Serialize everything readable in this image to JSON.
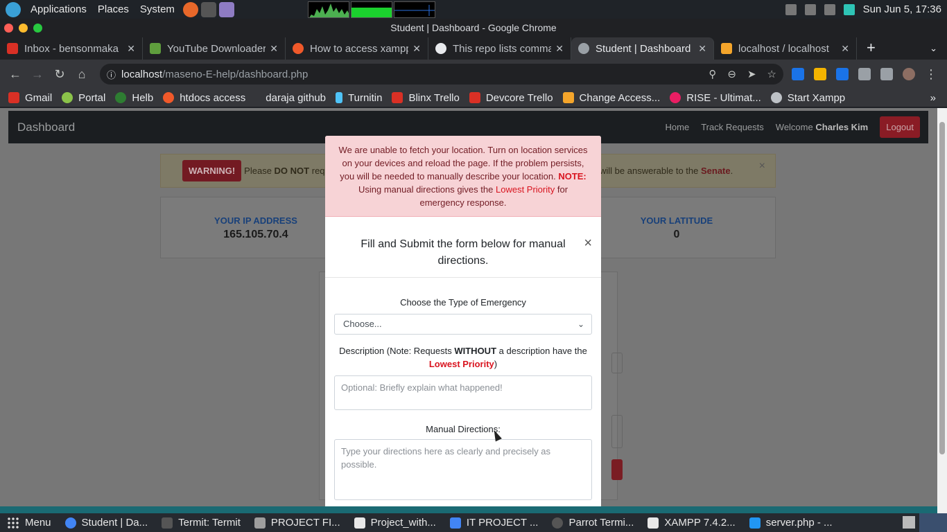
{
  "system_bar": {
    "menus": [
      "Applications",
      "Places",
      "System"
    ],
    "clock": "Sun Jun  5, 17:36"
  },
  "window": {
    "title": "Student | Dashboard - Google Chrome"
  },
  "tabs": [
    {
      "label": "Inbox - bensonmaka",
      "color": "#d93025"
    },
    {
      "label": "YouTube Downloader",
      "color": "#5f9e3d"
    },
    {
      "label": "How to access xampp",
      "color": "#f0592a"
    },
    {
      "label": "This repo lists comma",
      "color": "#e8eaed"
    },
    {
      "label": "Student | Dashboard",
      "color": "#9aa0a6"
    },
    {
      "label": "localhost / localhost",
      "color": "#f4a52b"
    }
  ],
  "address": {
    "host": "localhost",
    "path": "/maseno-E-help/dashboard.php"
  },
  "bookmarks": [
    {
      "label": "Gmail",
      "color": "#d93025"
    },
    {
      "label": "Portal",
      "color": "#8bc34a"
    },
    {
      "label": "Helb",
      "color": "#2e7d32"
    },
    {
      "label": "htdocs access",
      "color": "#f0592a"
    },
    {
      "label": "daraja github",
      "color": "#35363a"
    },
    {
      "label": "Turnitin",
      "color": "#4fc3f7"
    },
    {
      "label": "Blinx Trello",
      "color": "#d93025"
    },
    {
      "label": "Devcore Trello",
      "color": "#d93025"
    },
    {
      "label": "Change Access...",
      "color": "#f4a52b"
    },
    {
      "label": "RISE - Ultimat...",
      "color": "#e91e63"
    },
    {
      "label": "Start Xampp",
      "color": "#bdc1c6"
    }
  ],
  "page": {
    "brand": "Dashboard",
    "nav": {
      "home": "Home",
      "track": "Track Requests",
      "welcome_prefix": "Welcome",
      "user": "Charles Kim",
      "logout": "Logout"
    },
    "warning": {
      "badge": "WARNING!",
      "text_a": "Please",
      "text_b": "DO NOT",
      "text_c": "req",
      "right_a": "will be answerable to the",
      "right_b": "Senate",
      "right_c": ".",
      "close": "×"
    },
    "ip": {
      "label": "YOUR IP ADDRESS",
      "value": "165.105.70.4"
    },
    "lat": {
      "label": "YOUR LATITUDE",
      "value": "0"
    }
  },
  "modal": {
    "alert": {
      "a": "We are unable to fetch your location. Turn on location services on your devices and reload the page. If the problem persists, you will be needed to manually describe your location.",
      "note": "NOTE:",
      "b": "Using manual directions gives the",
      "priority": "Lowest Priority",
      "c": "for emergency response."
    },
    "title": "Fill and Submit the form below for manual directions.",
    "close": "×",
    "emergency_label": "Choose the Type of Emergency",
    "emergency_value": "Choose...",
    "desc_label_a": "Description (Note: Requests",
    "desc_label_b": "WITHOUT",
    "desc_label_c": "a description have the",
    "desc_priority": "Lowest Priority",
    "desc_paren": ")",
    "desc_placeholder": "Optional: Briefly explain what happened!",
    "directions_label": "Manual Directions:",
    "directions_placeholder": "Type your directions here as clearly and precisely as possible."
  },
  "taskbar": [
    {
      "label": "Menu",
      "color": "#e8e8e8"
    },
    {
      "label": "Student | Da...",
      "color": "#4285f4"
    },
    {
      "label": "Termit: Termit",
      "color": "#9e9e9e"
    },
    {
      "label": "PROJECT FI...",
      "color": "#9e9e9e"
    },
    {
      "label": "Project_with...",
      "color": "#e8e8e8"
    },
    {
      "label": "IT PROJECT ...",
      "color": "#4285f4"
    },
    {
      "label": "Parrot Termi...",
      "color": "#9e9e9e"
    },
    {
      "label": "XAMPP 7.4.2...",
      "color": "#e8e8e8"
    },
    {
      "label": "server.php - ...",
      "color": "#2196f3"
    }
  ]
}
